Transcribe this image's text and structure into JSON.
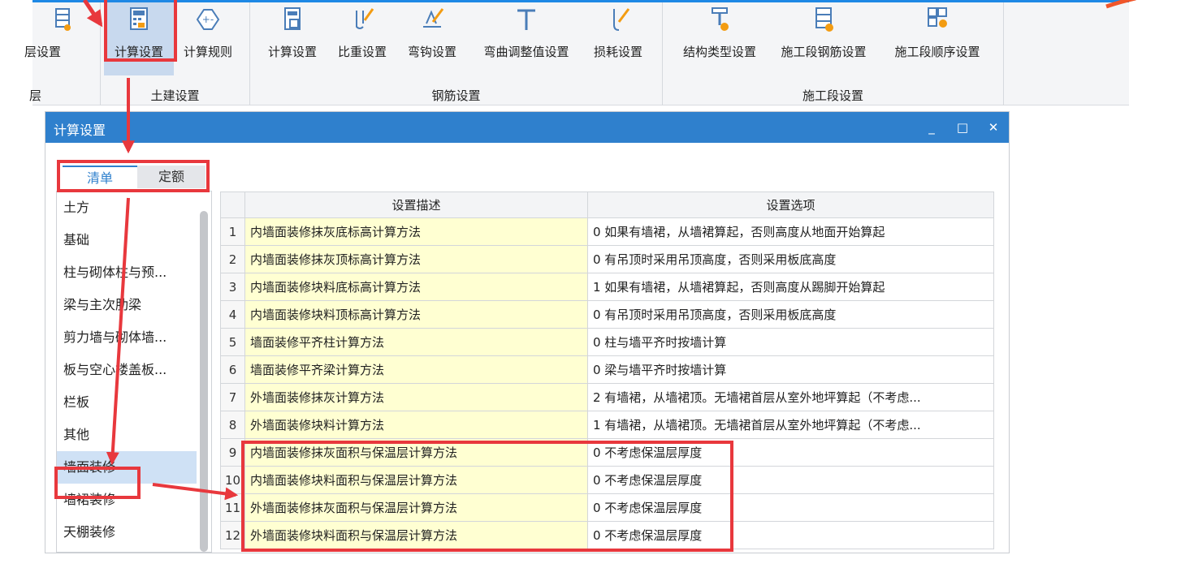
{
  "ribbon": {
    "buttons": [
      {
        "label": "层设置",
        "icon": "floor-settings-icon"
      },
      {
        "label": "计算设置",
        "icon": "calc-settings-icon"
      },
      {
        "label": "计算规则",
        "icon": "calc-rules-icon"
      },
      {
        "label": "计算设置",
        "icon": "rebar-calc-settings-icon"
      },
      {
        "label": "比重设置",
        "icon": "density-settings-icon"
      },
      {
        "label": "弯钩设置",
        "icon": "hook-settings-icon"
      },
      {
        "label": "弯曲调整值设置",
        "icon": "bend-adjust-icon"
      },
      {
        "label": "损耗设置",
        "icon": "loss-settings-icon"
      },
      {
        "label": "结构类型设置",
        "icon": "structure-type-icon"
      },
      {
        "label": "施工段钢筋设置",
        "icon": "section-rebar-icon"
      },
      {
        "label": "施工段顺序设置",
        "icon": "section-order-icon"
      }
    ],
    "groups": [
      "土建设置",
      "钢筋设置",
      "施工段设置"
    ]
  },
  "dialog": {
    "title": "计算设置",
    "controls": {
      "minimize": "_",
      "maximize": "□",
      "close": "✕"
    }
  },
  "tabs": [
    "清单",
    "定额"
  ],
  "categories": [
    "土方",
    "基础",
    "柱与砌体柱与预...",
    "梁与主次肋梁",
    "剪力墙与砌体墙...",
    "板与空心楼盖板...",
    "栏板",
    "其他",
    "墙面装修",
    "墙裙装修",
    "天棚装修"
  ],
  "selected_category": "墙面装修",
  "table": {
    "headers": [
      "设置描述",
      "设置选项"
    ],
    "rows": [
      {
        "n": "1",
        "desc": "内墙面装修抹灰底标高计算方法",
        "opt": "0 如果有墙裙，从墙裙算起，否则高度从地面开始算起"
      },
      {
        "n": "2",
        "desc": "内墙面装修抹灰顶标高计算方法",
        "opt": "0 有吊顶时采用吊顶高度，否则采用板底高度"
      },
      {
        "n": "3",
        "desc": "内墙面装修块料底标高计算方法",
        "opt": "1 如果有墙裙，从墙裙算起，否则高度从踢脚开始算起"
      },
      {
        "n": "4",
        "desc": "内墙面装修块料顶标高计算方法",
        "opt": "0 有吊顶时采用吊顶高度，否则采用板底高度"
      },
      {
        "n": "5",
        "desc": "墙面装修平齐柱计算方法",
        "opt": "0 柱与墙平齐时按墙计算"
      },
      {
        "n": "6",
        "desc": "墙面装修平齐梁计算方法",
        "opt": "0 梁与墙平齐时按墙计算"
      },
      {
        "n": "7",
        "desc": "外墙面装修抹灰计算方法",
        "opt": "2 有墙裙，从墙裙顶。无墙裙首层从室外地坪算起（不考虑..."
      },
      {
        "n": "8",
        "desc": "外墙面装修块料计算方法",
        "opt": "1 有墙裙，从墙裙顶。无墙裙首层从室外地坪算起（不考虑..."
      },
      {
        "n": "9",
        "desc": "内墙面装修抹灰面积与保温层计算方法",
        "opt": "0 不考虑保温层厚度"
      },
      {
        "n": "10",
        "desc": "内墙面装修块料面积与保温层计算方法",
        "opt": "0 不考虑保温层厚度"
      },
      {
        "n": "11",
        "desc": "外墙面装修抹灰面积与保温层计算方法",
        "opt": "0 不考虑保温层厚度"
      },
      {
        "n": "12",
        "desc": "外墙面装修块料面积与保温层计算方法",
        "opt": "0 不考虑保温层厚度"
      }
    ]
  },
  "colors": {
    "accent": "#2f80cd",
    "highlight": "#e8383d",
    "desc_bg": "#ffffd2"
  }
}
